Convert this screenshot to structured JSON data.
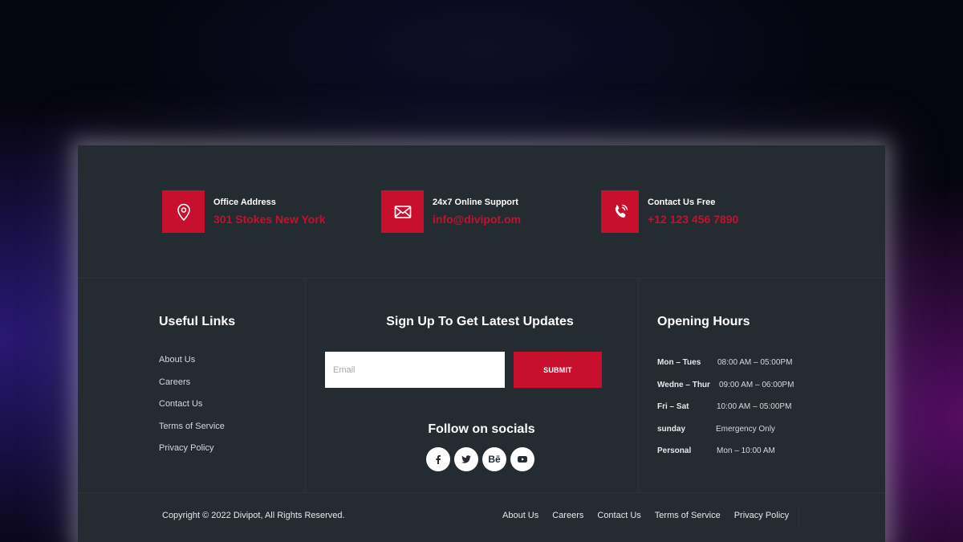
{
  "contacts": [
    {
      "label": "Office Address",
      "value": "301 Stokes New York",
      "icon": "map-pin-icon"
    },
    {
      "label": "24x7 Online Support",
      "value": "info@divipot.om",
      "icon": "envelope-icon"
    },
    {
      "label": "Contact Us Free",
      "value": "+12 123 456 7890",
      "icon": "phone-icon"
    }
  ],
  "useful_links": {
    "title": "Useful Links",
    "items": [
      "About Us",
      "Careers",
      "Contact Us",
      "Terms of Service",
      "Privacy Policy"
    ]
  },
  "newsletter": {
    "title": "Sign Up To Get Latest Updates",
    "email_placeholder": "Email",
    "submit_label": "SUBMIT",
    "follow_title": "Follow on socials",
    "socials": [
      "facebook-icon",
      "twitter-icon",
      "behance-icon",
      "youtube-icon"
    ]
  },
  "hours": {
    "title": "Opening Hours",
    "rows": [
      {
        "day": "Mon – Tues",
        "time": "08:00 AM – 05:00PM"
      },
      {
        "day": "Wedne – Thur",
        "time": "09:00 AM – 06:00PM"
      },
      {
        "day": "Fri – Sat",
        "time": "10:00 AM – 05:00PM"
      },
      {
        "day": "sunday",
        "time": "Emergency Only"
      },
      {
        "day": "Personal",
        "time": "Mon – 10:00 AM"
      }
    ]
  },
  "footer": {
    "copyright": "Copyright © 2022 Divipot, All Rights Reserved.",
    "links": [
      "About Us",
      "Careers",
      "Contact Us",
      "Terms of Service",
      "Privacy Policy"
    ]
  },
  "colors": {
    "panel_bg": "#242b31",
    "accent": "#c8102e",
    "text": "#ffffff"
  }
}
